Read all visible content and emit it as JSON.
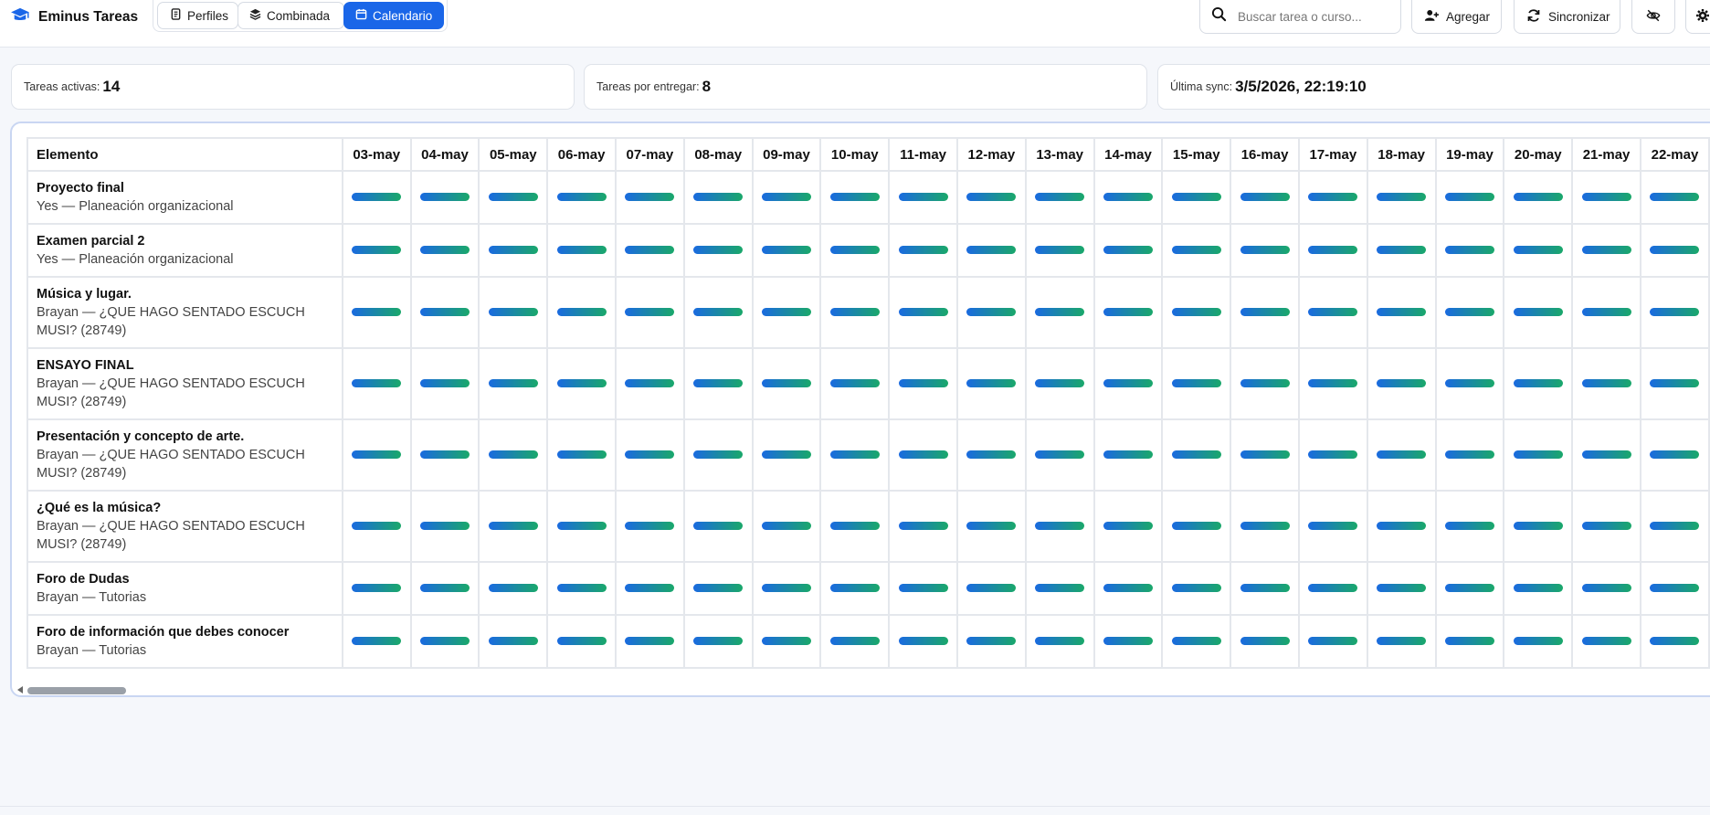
{
  "app": {
    "title": "Eminus Tareas",
    "accent_color": "#1a66e8",
    "brand_icon": "graduation-cap-icon"
  },
  "tabs": [
    {
      "label": "Perfiles",
      "icon": "id-card-icon",
      "active": false
    },
    {
      "label": "Combinada",
      "icon": "layers-icon",
      "active": false
    },
    {
      "label": "Calendario",
      "icon": "calendar-icon",
      "active": true
    }
  ],
  "search": {
    "placeholder": "Buscar tarea o curso..."
  },
  "toolbar": {
    "add_label": "Agregar",
    "sync_label": "Sincronizar",
    "hide_icon": "eye-off-icon",
    "settings_icon": "gear-icon"
  },
  "stats": {
    "active_label": "Tareas activas:",
    "active_value": "14",
    "pending_label": "Tareas por entregar:",
    "pending_value": "8",
    "sync_label": "Última sync:",
    "sync_value": "3/5/2026, 22:19:10"
  },
  "calendar": {
    "element_header": "Elemento",
    "dates": [
      "03-may",
      "04-may",
      "05-may",
      "06-may",
      "07-may",
      "08-may",
      "09-may",
      "10-may",
      "11-may",
      "12-may",
      "13-may",
      "14-may",
      "15-may",
      "16-may",
      "17-may",
      "18-may",
      "19-may",
      "20-may",
      "21-may",
      "22-may"
    ],
    "rows": [
      {
        "title": "Proyecto final",
        "subtitle": "Yes — Planeación organizacional",
        "first_bar": 0,
        "last_bar": 19
      },
      {
        "title": "Examen parcial 2",
        "subtitle": "Yes — Planeación organizacional",
        "first_bar": 0,
        "last_bar": 19
      },
      {
        "title": "Música y lugar.",
        "subtitle": "Brayan — ¿QUE HAGO SENTADO ESCUCH MUSI? (28749)",
        "first_bar": 0,
        "last_bar": 19
      },
      {
        "title": "ENSAYO FINAL",
        "subtitle": "Brayan — ¿QUE HAGO SENTADO ESCUCH MUSI? (28749)",
        "first_bar": 0,
        "last_bar": 19
      },
      {
        "title": "Presentación y concepto de arte.",
        "subtitle": "Brayan — ¿QUE HAGO SENTADO ESCUCH MUSI? (28749)",
        "first_bar": 0,
        "last_bar": 19
      },
      {
        "title": "¿Qué es la música?",
        "subtitle": "Brayan — ¿QUE HAGO SENTADO ESCUCH MUSI? (28749)",
        "first_bar": 0,
        "last_bar": 19
      },
      {
        "title": "Foro de Dudas",
        "subtitle": "Brayan — Tutorias",
        "first_bar": 0,
        "last_bar": 19
      },
      {
        "title": "Foro de información que debes conocer",
        "subtitle": "Brayan — Tutorias",
        "first_bar": 0,
        "last_bar": 19
      }
    ],
    "bar_color_start": "#1a6ae0",
    "bar_color_end": "#1aa86a"
  }
}
